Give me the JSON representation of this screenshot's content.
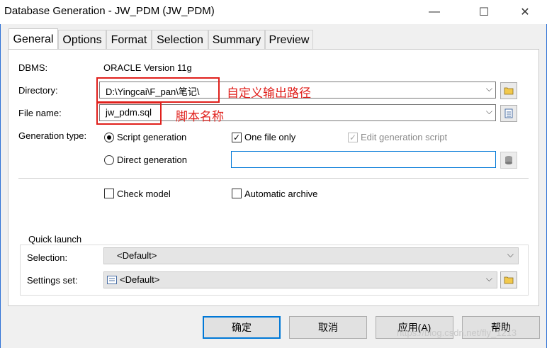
{
  "window": {
    "title": "Database Generation - JW_PDM (JW_PDM)",
    "minimize_glyph": "—",
    "maximize_glyph": "☐",
    "close_glyph": "✕"
  },
  "tabs": [
    {
      "label": "General"
    },
    {
      "label": "Options"
    },
    {
      "label": "Format"
    },
    {
      "label": "Selection"
    },
    {
      "label": "Summary"
    },
    {
      "label": "Preview"
    }
  ],
  "general": {
    "dbms_label": "DBMS:",
    "dbms_value": "ORACLE Version 11g",
    "directory_label": "Directory:",
    "directory_value": "D:\\Yingcai\\F_pan\\笔记\\",
    "directory_annotation": "自定义输出路径",
    "filename_label": "File name:",
    "filename_value": "jw_pdm.sql",
    "filename_annotation": "脚本名称",
    "generation_type_label": "Generation type:",
    "script_generation_label": "Script generation",
    "direct_generation_label": "Direct generation",
    "one_file_only_label": "One file only",
    "edit_script_label": "Edit generation script",
    "check_model_label": "Check model",
    "automatic_archive_label": "Automatic archive",
    "script_generation_selected": true,
    "one_file_only_checked": true,
    "edit_script_checked": true,
    "check_model_checked": false,
    "automatic_archive_checked": false
  },
  "quick_launch": {
    "group_label": "Quick launch",
    "selection_label": "Selection:",
    "selection_value": "<Default>",
    "settings_label": "Settings set:",
    "settings_value": "<Default>"
  },
  "buttons": {
    "ok": "确定",
    "cancel": "取消",
    "apply": "应用(A)",
    "help": "帮助"
  },
  "watermark": "https://blog.csdn.net/fly_1213",
  "colors": {
    "annotation_red": "#e0201c",
    "default_button_border": "#0078d7"
  }
}
